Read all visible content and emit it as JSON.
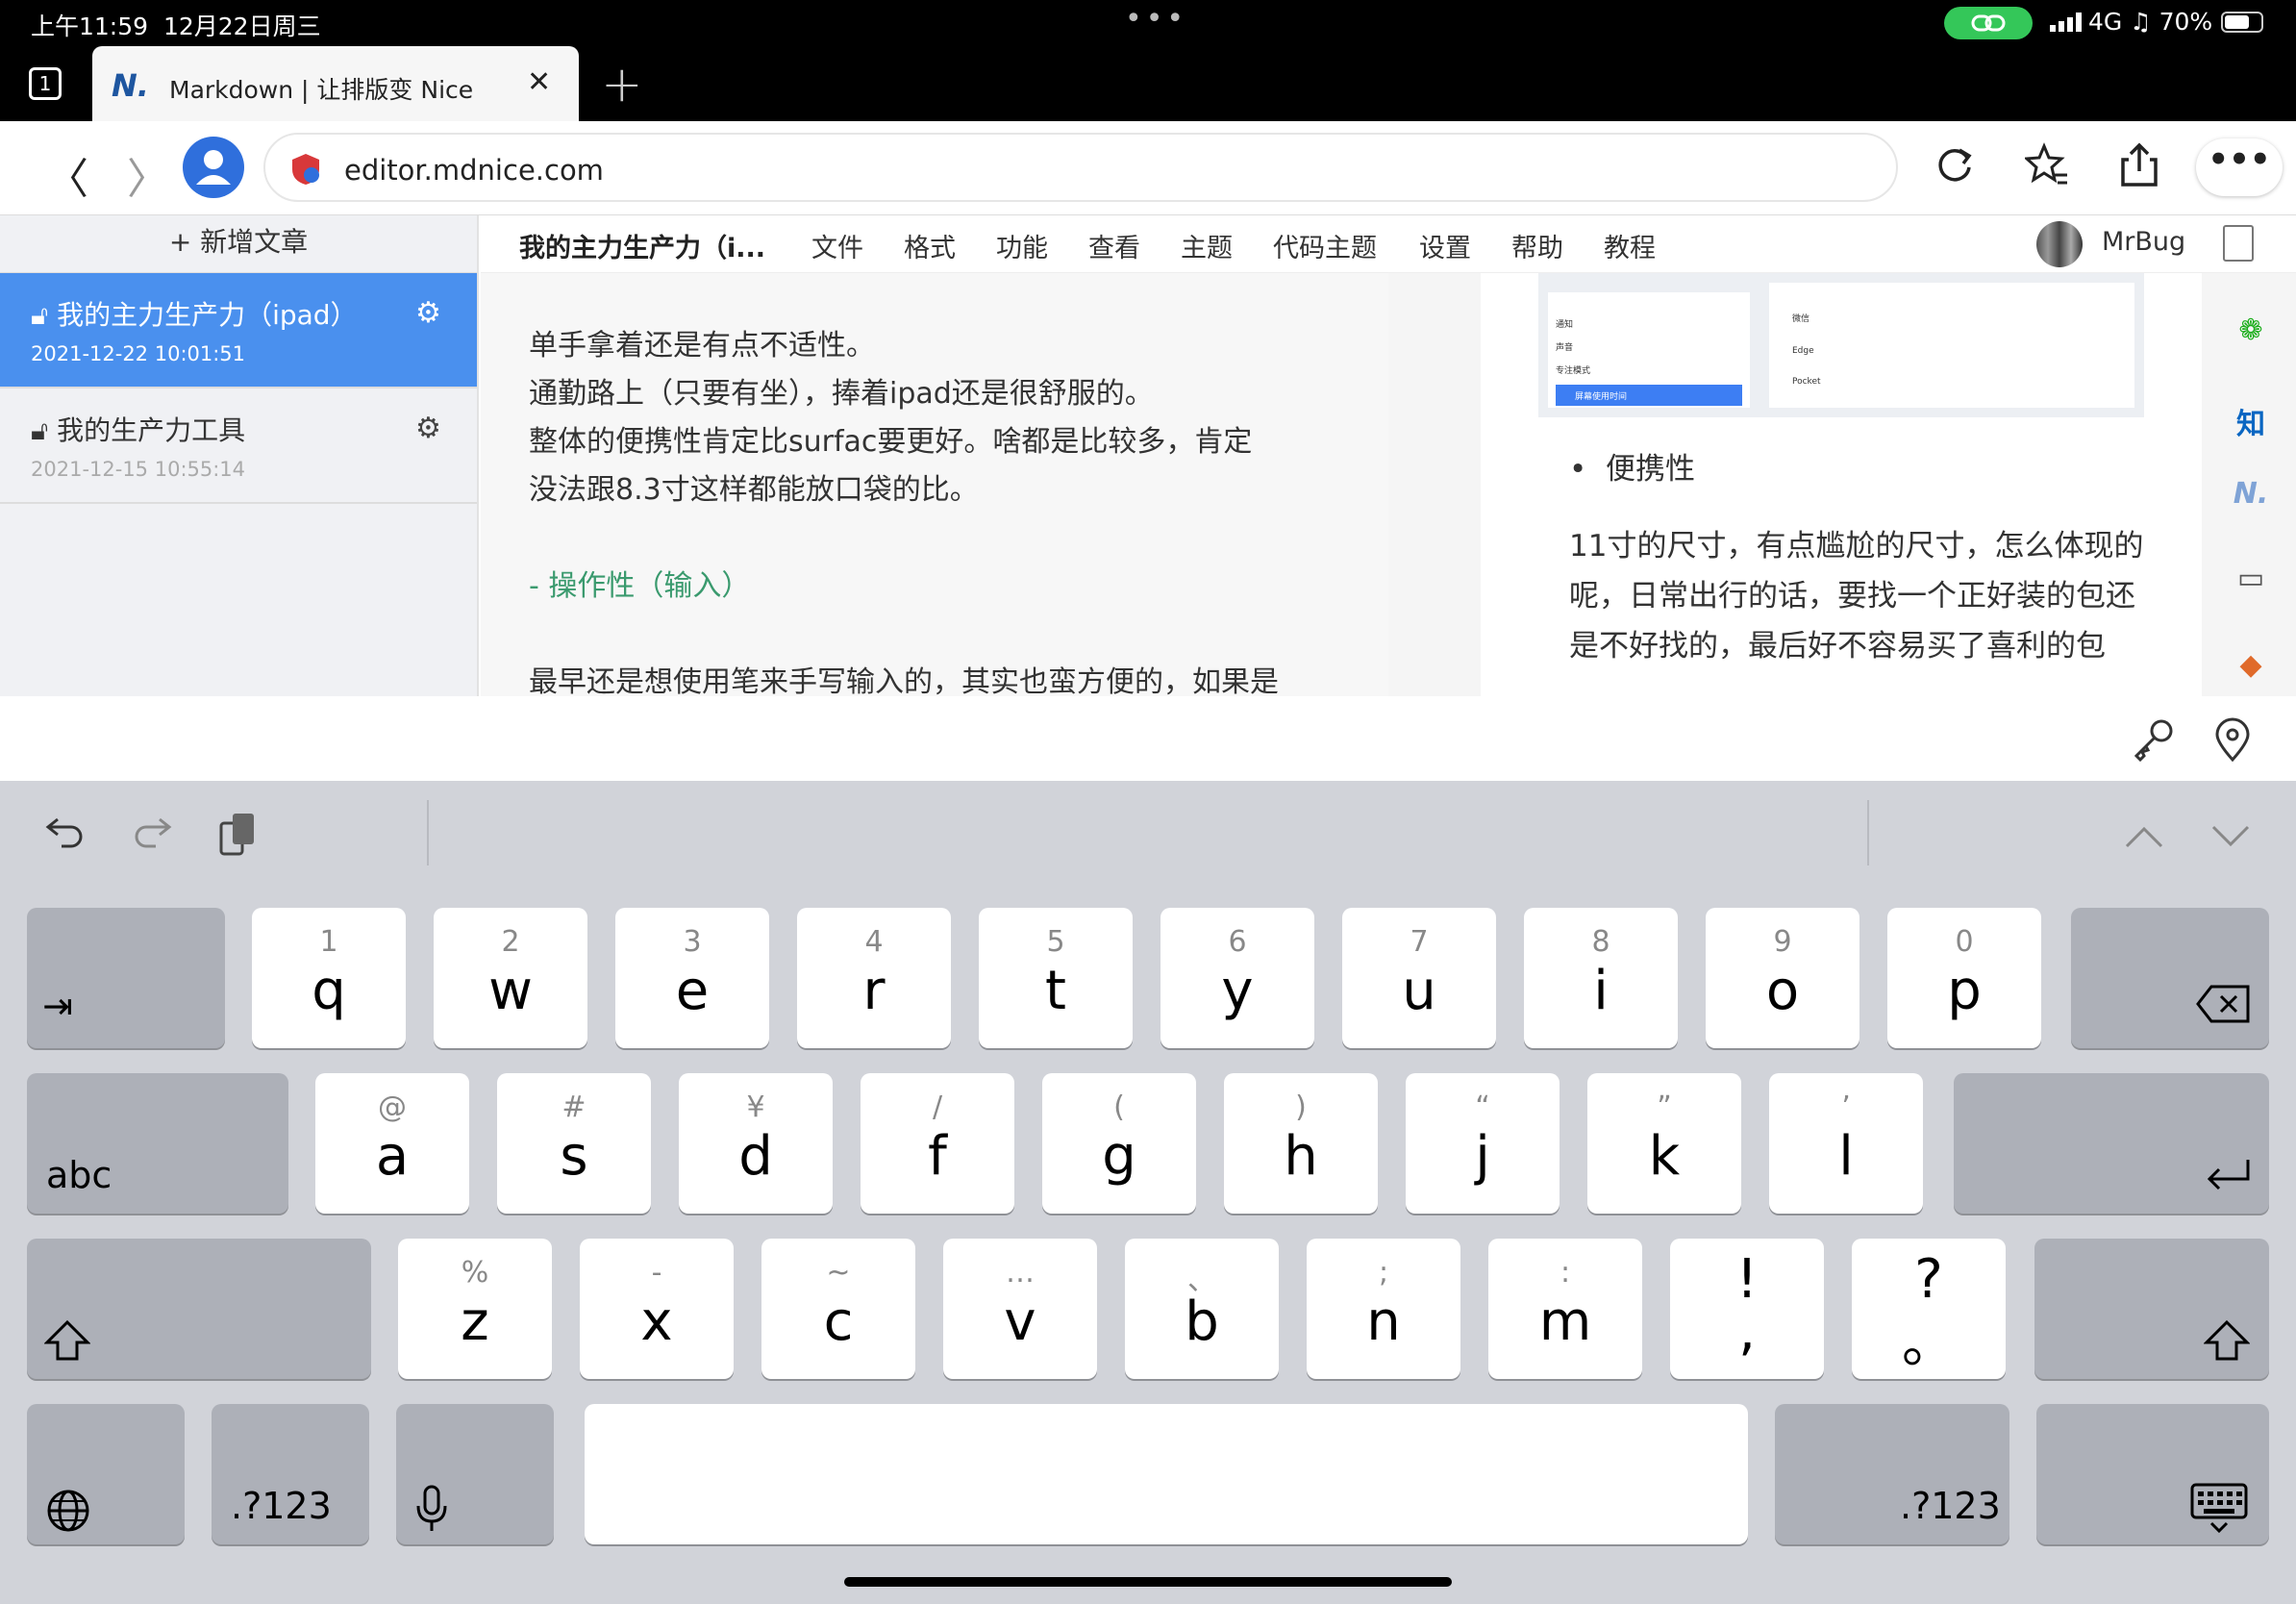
{
  "status": {
    "time": "上午11:59",
    "date": "12月22日周三",
    "network": "4G",
    "battery": "70%",
    "battery_level": 0.7
  },
  "tabbar": {
    "tab_count": "1",
    "tab_title": "Markdown | 让排版变 Nice",
    "logo_text": "N."
  },
  "urlbar": {
    "url": "editor.mdnice.com"
  },
  "sidebar": {
    "new_article": "+ 新增文章",
    "articles": [
      {
        "title": "我的主力生产力（ipad）",
        "date": "2021-12-22 10:01:51"
      },
      {
        "title": "我的生产力工具",
        "date": "2021-12-15 10:55:14"
      }
    ]
  },
  "menubar": {
    "doc_title": "我的主力生产力（i...",
    "menus": [
      "文件",
      "格式",
      "功能",
      "查看",
      "主题",
      "代码主题",
      "设置",
      "帮助",
      "教程"
    ],
    "user": "MrBug"
  },
  "editor": {
    "lines": [
      "单手拿着还是有点不适性。",
      "通勤路上（只要有坐），捧着ipad还是很舒服的。",
      "整体的便携性肯定比surfac要更好。啥都是比较多，肯定",
      "没法跟8.3寸这样都能放口袋的比。",
      "- 操作性（输入）",
      "最早还是想使用笔来手写输入的，其实也蛮方便的，如果是"
    ]
  },
  "preview": {
    "shot_items": [
      "通知",
      "声音",
      "专注模式",
      "屏幕使用时间"
    ],
    "shot_apps": [
      "微信",
      "Edge",
      "Pocket"
    ],
    "bullet": "便携性",
    "paragraph": [
      "11寸的尺寸，有点尴尬的尺寸，怎么体现的",
      "呢，日常出行的话，要找一个正好装的包还",
      "是不好找的，最后好不容易买了喜利的包"
    ],
    "rail": [
      "wechat-icon",
      "知",
      "N.",
      "monitor-icon",
      "app-icon"
    ]
  },
  "keyboard": {
    "row1": [
      {
        "hint": "1",
        "key": "q"
      },
      {
        "hint": "2",
        "key": "w"
      },
      {
        "hint": "3",
        "key": "e"
      },
      {
        "hint": "4",
        "key": "r"
      },
      {
        "hint": "5",
        "key": "t"
      },
      {
        "hint": "6",
        "key": "y"
      },
      {
        "hint": "7",
        "key": "u"
      },
      {
        "hint": "8",
        "key": "i"
      },
      {
        "hint": "9",
        "key": "o"
      },
      {
        "hint": "0",
        "key": "p"
      }
    ],
    "row2": [
      {
        "hint": "@",
        "key": "a"
      },
      {
        "hint": "#",
        "key": "s"
      },
      {
        "hint": "¥",
        "key": "d"
      },
      {
        "hint": "/",
        "key": "f"
      },
      {
        "hint": "(",
        "key": "g"
      },
      {
        "hint": ")",
        "key": "h"
      },
      {
        "hint": "“",
        "key": "j"
      },
      {
        "hint": "”",
        "key": "k"
      },
      {
        "hint": "’",
        "key": "l"
      }
    ],
    "row3": [
      {
        "hint": "%",
        "key": "z"
      },
      {
        "hint": "-",
        "key": "x"
      },
      {
        "hint": "~",
        "key": "c"
      },
      {
        "hint": "…",
        "key": "v"
      },
      {
        "hint": "、",
        "key": "b"
      },
      {
        "hint": ";",
        "key": "n"
      },
      {
        "hint": ":",
        "key": "m"
      },
      {
        "hint": "!",
        "key": ","
      },
      {
        "hint": "?",
        "key": "。"
      }
    ],
    "abc": "abc",
    "num_left": ".?123",
    "num_right": ".?123"
  }
}
